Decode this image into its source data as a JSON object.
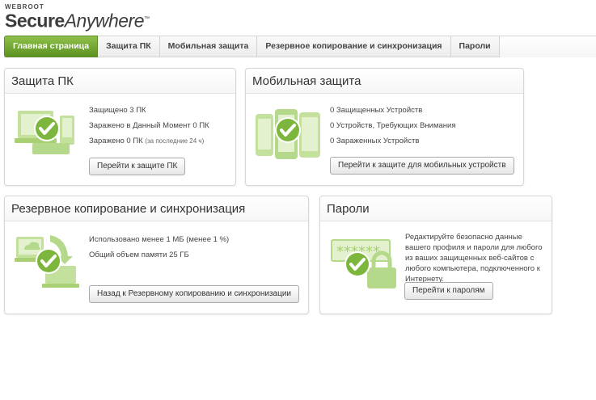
{
  "logo": {
    "brand": "WEBROOT",
    "product_bold": "Secure",
    "product_italic": "Anywhere"
  },
  "tabs": [
    "Главная страница",
    "Защита ПК",
    "Мобильная защита",
    "Резервное копирование и синхронизация",
    "Пароли"
  ],
  "pc": {
    "title": "Защита ПК",
    "protected": "Защищено 3 ПК",
    "infected_now": "Заражено в Данный Момент 0 ПК",
    "infected": "Заражено 0 ПК",
    "infected_note": "(за последние 24 ч)",
    "button": "Перейти к защите ПК"
  },
  "mobile": {
    "title": "Мобильная защита",
    "protected": "0 Защищенных Устройств",
    "attention": "0 Устройств, Требующих Внимания",
    "infected": "0 Зараженных Устройств",
    "button": "Перейти к защите для мобильных устройств"
  },
  "backup": {
    "title": "Резервное копирование и синхронизация",
    "used": "Использовано менее 1 МБ (менее 1 %)",
    "total": "Общий объем памяти 25 ГБ",
    "button": "Назад к Резервному копированию и синхронизации"
  },
  "passwords": {
    "title": "Пароли",
    "stars": "******",
    "description": "Редактируйте безопасно данные вашего профиля и пароли для любого из ваших защищенных веб-сайтов с любого компьютера, подключенного к Интернету.",
    "button": "Перейти к паролям"
  },
  "colors": {
    "accent": "#6fa832",
    "illustration": "#b5d98a",
    "check": "#7cb63c"
  }
}
